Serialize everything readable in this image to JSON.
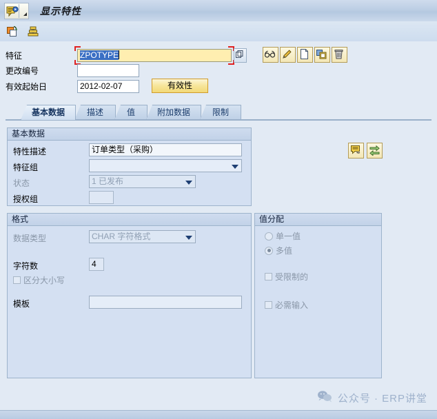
{
  "window": {
    "title": "显示特性",
    "system_menu_icon": "sap-characteristic-icon",
    "dropdown_icon": "menu-arrow-icon"
  },
  "toolbar": {
    "buttons": [
      {
        "name": "copy-icon",
        "label": "复制"
      },
      {
        "name": "hierarchy-icon",
        "label": "层次"
      }
    ]
  },
  "header_form": {
    "characteristic": {
      "label": "特征",
      "value": "ZPOTYPE",
      "placeholder": "",
      "focused": true,
      "search_help_icon": "search-help-icon"
    },
    "change_number": {
      "label": "更改编号",
      "value": "",
      "placeholder": ""
    },
    "valid_from": {
      "label": "有效起始日",
      "value": "2012-02-07",
      "placeholder": ""
    },
    "validity_button": {
      "label": "有效性"
    },
    "action_buttons": [
      {
        "name": "display-glasses-icon",
        "label": "显示"
      },
      {
        "name": "edit-pencil-icon",
        "label": "修改"
      },
      {
        "name": "create-page-icon",
        "label": "创建"
      },
      {
        "name": "copy-from-icon",
        "label": "复制自"
      },
      {
        "name": "delete-trash-icon",
        "label": "删除"
      }
    ]
  },
  "tabs": [
    {
      "label": "基本数据",
      "active": true
    },
    {
      "label": "描述",
      "active": false
    },
    {
      "label": "值",
      "active": false
    },
    {
      "label": "附加数据",
      "active": false
    },
    {
      "label": "限制",
      "active": false
    }
  ],
  "basic_data": {
    "title": "基本数据",
    "description": {
      "label": "特性描述",
      "value": "订单类型（采购）"
    },
    "char_group": {
      "label": "特征组",
      "value": "",
      "placeholder": ""
    },
    "status": {
      "label": "状态",
      "value": "1 已发布"
    },
    "auth_group": {
      "label": "授权组",
      "value": ""
    },
    "side_buttons": [
      {
        "name": "documentation-icon",
        "label": "文档"
      },
      {
        "name": "exchange-arrows-icon",
        "label": "转换"
      }
    ]
  },
  "format": {
    "title": "格式",
    "data_type": {
      "label": "数据类型",
      "value": "CHAR 字符格式"
    },
    "number_of_chars": {
      "label": "字符数",
      "value": "4"
    },
    "case_sensitive": {
      "label": "区分大小写",
      "checked": false
    },
    "template": {
      "label": "模板",
      "value": "",
      "placeholder": ""
    }
  },
  "value_assignment": {
    "title": "值分配",
    "single_value": {
      "label": "单一值",
      "selected": false
    },
    "multiple_values": {
      "label": "多值",
      "selected": true
    },
    "restricted": {
      "label": "受限制的",
      "checked": false
    },
    "entry_required": {
      "label": "必需输入",
      "checked": false
    }
  },
  "watermark": {
    "icon": "wechat-icon",
    "text": "公众号 · ERP讲堂"
  },
  "colors": {
    "page_bg": "#e2eaf4",
    "group_bg": "#d4e0f2",
    "focus_field_bg": "#ffeeb0",
    "accent_button": "#f2d977",
    "selection_blue": "#3a6fc4",
    "focus_bracket_red": "#e02020"
  }
}
